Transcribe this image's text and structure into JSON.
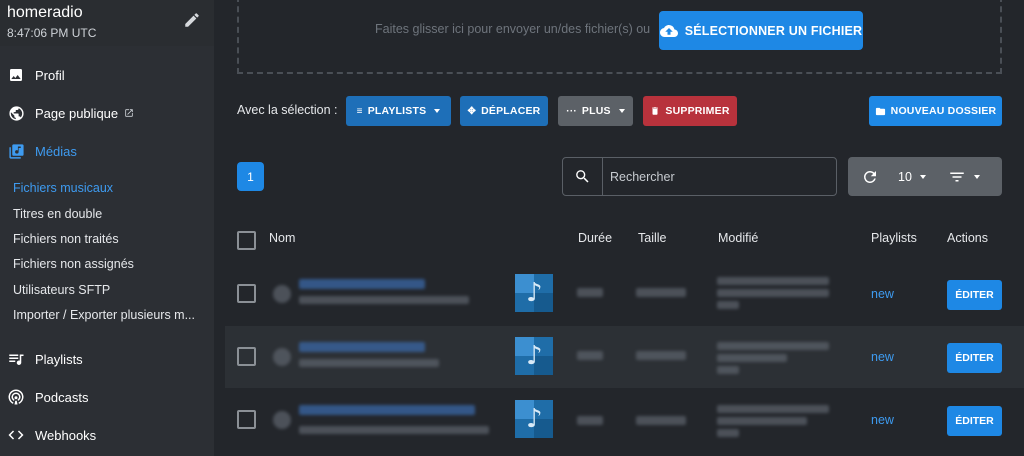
{
  "station": {
    "name": "homeradio",
    "time": "8:47:06 PM UTC"
  },
  "sidebar": {
    "items": [
      {
        "label": "Profil"
      },
      {
        "label": "Page publique"
      },
      {
        "label": "Médias"
      },
      {
        "label": "Playlists"
      },
      {
        "label": "Podcasts"
      },
      {
        "label": "Webhooks"
      }
    ],
    "media_sub": [
      {
        "label": "Fichiers musicaux"
      },
      {
        "label": "Titres en double"
      },
      {
        "label": "Fichiers non traités"
      },
      {
        "label": "Fichiers non assignés"
      },
      {
        "label": "Utilisateurs SFTP"
      },
      {
        "label": "Importer / Exporter plusieurs m..."
      }
    ]
  },
  "upload": {
    "hint": "Faites glisser ici pour envoyer un/des fichier(s) ou",
    "select_label": "SÉLECTIONNER UN FICHIER"
  },
  "selection": {
    "label": "Avec la sélection :",
    "playlists": "PLAYLISTS",
    "move": "DÉPLACER",
    "more": "PLUS",
    "delete": "SUPPRIMER",
    "new_folder": "NOUVEAU DOSSIER"
  },
  "pagination": {
    "current_page": "1"
  },
  "search": {
    "placeholder": "Rechercher"
  },
  "per_page": "10",
  "table": {
    "headers": {
      "name": "Nom",
      "duration": "Durée",
      "size": "Taille",
      "modified": "Modifié",
      "playlists": "Playlists",
      "actions": "Actions"
    },
    "rows": [
      {
        "playlist": "new",
        "action": "ÉDITER"
      },
      {
        "playlist": "new",
        "action": "ÉDITER"
      },
      {
        "playlist": "new",
        "action": "ÉDITER"
      }
    ]
  },
  "colors": {
    "accent": "#1e88e5",
    "danger": "#b8323c",
    "sidebar_bg": "#2c2f34",
    "main_bg": "#23262b"
  }
}
